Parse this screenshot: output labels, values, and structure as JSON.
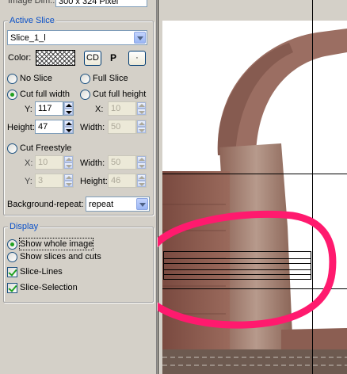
{
  "top_field": {
    "label": "Image Dim.:",
    "value": "300 x 324 Pixel"
  },
  "active_slice": {
    "group_title": "Active Slice",
    "slice_name": "Slice_1_l",
    "color_label": "Color:",
    "cd_button": "CD",
    "p_button": "P",
    "dot_button": "·",
    "no_slice": "No Slice",
    "full_slice": "Full Slice",
    "cut_full_width": "Cut full width",
    "cut_full_height": "Cut full height",
    "y_label": "Y:",
    "y_value": "117",
    "x_label": "X:",
    "x_value": "10",
    "height_label": "Height:",
    "height_value": "47",
    "width_label": "Width:",
    "width_value": "50",
    "cut_freestyle": "Cut Freestyle",
    "fx_label": "X:",
    "fx_value": "10",
    "fwidth_label": "Width:",
    "fwidth_value": "50",
    "fy_label": "Y:",
    "fy_value": "3",
    "fheight_label": "Height:",
    "fheight_value": "46",
    "bg_repeat_label": "Background-repeat:",
    "bg_repeat_value": "repeat"
  },
  "display": {
    "group_title": "Display",
    "show_whole_image": "Show whole image",
    "show_slices_and_cuts": "Show slices and cuts",
    "slice_lines": "Slice-Lines",
    "slice_selection": "Slice-Selection"
  },
  "colors": {
    "highlight_circle": "#ff1a6e",
    "group_title": "#0a50c8"
  },
  "icons": {
    "radio": "radio-button",
    "checkbox": "checkbox",
    "spin": "spin-arrows",
    "dropdown": "chevron-down"
  }
}
